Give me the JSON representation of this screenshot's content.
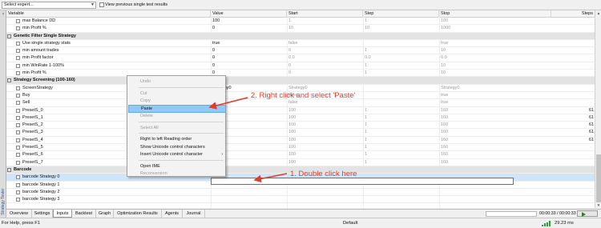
{
  "toolbar": {
    "expert_select": "Select expert...",
    "view_results_label": "View previous single test results"
  },
  "sidebar": {
    "title": "Strategy Tester"
  },
  "columns": {
    "variable": "Variable",
    "value": "Value",
    "start": "Start",
    "step": "Step",
    "stop": "Stop",
    "steps": "Steps"
  },
  "rows": [
    {
      "type": "param",
      "name": "max Balance DD",
      "value": "100",
      "start": "1",
      "step": "1",
      "stop": "100",
      "steps": ""
    },
    {
      "type": "param",
      "name": "min Profit %",
      "value": "0",
      "start": "10",
      "step": "10",
      "stop": "1000",
      "steps": ""
    },
    {
      "type": "group",
      "name": "Genetic Filter Single Strategy"
    },
    {
      "type": "param",
      "name": "Use single strategy stats",
      "value": "true",
      "start": "false",
      "step": "",
      "stop": "true",
      "steps": ""
    },
    {
      "type": "param",
      "name": "min amount trades",
      "value": "0",
      "start": "0",
      "step": "1",
      "stop": "10",
      "steps": ""
    },
    {
      "type": "param",
      "name": "min Profit factor",
      "value": "0",
      "start": "0.0",
      "step": "0.0",
      "stop": "0.0",
      "steps": ""
    },
    {
      "type": "param",
      "name": "min WinRate 1-100%",
      "value": "0",
      "start": "0",
      "step": "1",
      "stop": "10",
      "steps": ""
    },
    {
      "type": "param",
      "name": "min Profit %",
      "value": "0",
      "start": "0",
      "step": "1",
      "stop": "10",
      "steps": ""
    },
    {
      "type": "group",
      "name": "Strategy Screening (100-160)"
    },
    {
      "type": "param",
      "name": "ScreenStrategy",
      "value": "Strategy0",
      "start": "Strategy0",
      "step": "",
      "stop": "Strategy0",
      "steps": ""
    },
    {
      "type": "param",
      "name": "Buy",
      "value": "true",
      "start": "false",
      "step": "",
      "stop": "true",
      "steps": ""
    },
    {
      "type": "param",
      "name": "Sell",
      "value": "true",
      "start": "false",
      "step": "",
      "stop": "true",
      "steps": ""
    },
    {
      "type": "param",
      "name": "PresetS_0",
      "value": "100",
      "start": "100",
      "step": "1",
      "stop": "160",
      "steps": "61"
    },
    {
      "type": "param",
      "name": "PresetS_1",
      "value": "100",
      "start": "100",
      "step": "1",
      "stop": "160",
      "steps": "61"
    },
    {
      "type": "param",
      "name": "PresetS_2",
      "value": "100",
      "start": "100",
      "step": "1",
      "stop": "160",
      "steps": "61"
    },
    {
      "type": "param",
      "name": "PresetS_3",
      "value": "100",
      "start": "100",
      "step": "1",
      "stop": "160",
      "steps": "61"
    },
    {
      "type": "param",
      "name": "PresetS_4",
      "value": "100",
      "start": "100",
      "step": "1",
      "stop": "160",
      "steps": "61"
    },
    {
      "type": "param",
      "name": "PresetS_5",
      "value": "100",
      "start": "100",
      "step": "1",
      "stop": "160",
      "steps": ""
    },
    {
      "type": "param",
      "name": "PresetS_6",
      "value": "100",
      "start": "100",
      "step": "1",
      "stop": "160",
      "steps": ""
    },
    {
      "type": "param",
      "name": "PresetS_7",
      "value": "100",
      "start": "100",
      "step": "1",
      "stop": "160",
      "steps": ""
    },
    {
      "type": "group",
      "name": "Barcode"
    },
    {
      "type": "param",
      "name": "barcode Strategy 0",
      "value": "",
      "start": "",
      "step": "",
      "stop": "",
      "steps": "",
      "selected": true
    },
    {
      "type": "param",
      "name": "barcode Strategy 1",
      "value": "",
      "start": "",
      "step": "",
      "stop": "",
      "steps": ""
    },
    {
      "type": "param",
      "name": "barcode Strategy 2",
      "value": "",
      "start": "",
      "step": "",
      "stop": "",
      "steps": ""
    },
    {
      "type": "param",
      "name": "barcode Strategy 3",
      "value": "",
      "start": "",
      "step": "",
      "stop": "",
      "steps": ""
    }
  ],
  "context_menu": [
    {
      "label": "Undo",
      "enabled": false
    },
    {
      "type": "separator"
    },
    {
      "label": "Cut",
      "enabled": false
    },
    {
      "label": "Copy",
      "enabled": false
    },
    {
      "label": "Paste",
      "enabled": true,
      "highlighted": true
    },
    {
      "label": "Delete",
      "enabled": false
    },
    {
      "type": "separator"
    },
    {
      "label": "Select All",
      "enabled": false
    },
    {
      "type": "separator"
    },
    {
      "label": "Right to left Reading order",
      "enabled": true
    },
    {
      "label": "Show Unicode control characters",
      "enabled": true
    },
    {
      "label": "Insert Unicode control character",
      "enabled": true,
      "submenu": true
    },
    {
      "type": "separator"
    },
    {
      "label": "Open IME",
      "enabled": true
    },
    {
      "label": "Reconversion",
      "enabled": false
    }
  ],
  "annotations": {
    "step2": "2. Right click and select 'Paste'",
    "step1": "1. Double click here",
    "color": "#e5392a"
  },
  "tabs": [
    "Overview",
    "Settings",
    "Inputs",
    "Backtest",
    "Graph",
    "Optimization Results",
    "Agents",
    "Journal"
  ],
  "active_tab": "Inputs",
  "tester_status": {
    "time": "00:00:33 / 00:00:33"
  },
  "statusbar": {
    "help": "For Help, press F1",
    "profile": "Default",
    "connection": "29.23 ms"
  }
}
